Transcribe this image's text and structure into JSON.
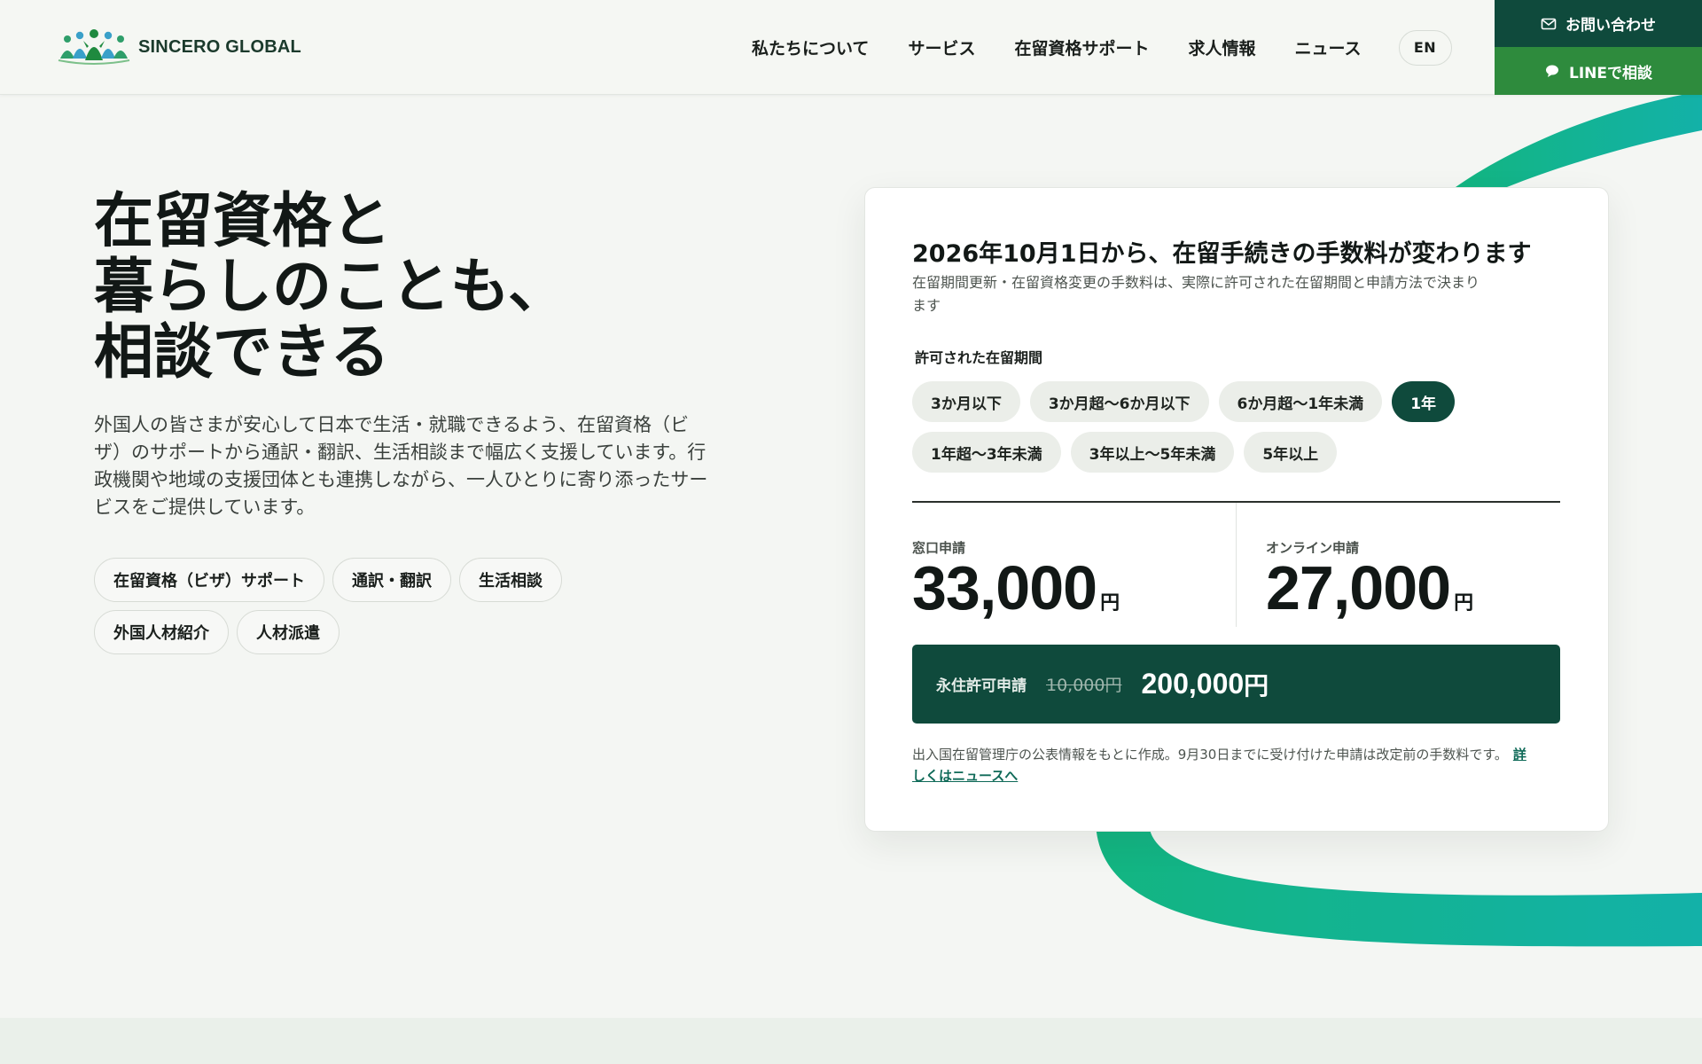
{
  "brand": {
    "name": "SINCERO GLOBAL"
  },
  "nav": {
    "items": [
      "私たちについて",
      "サービス",
      "在留資格サポート",
      "求人情報",
      "ニュース"
    ],
    "lang": "EN"
  },
  "header_cta": {
    "contact": "お問い合わせ",
    "line": "LINEで相談"
  },
  "hero": {
    "title_lines": [
      "在留資格と",
      "暮らしのことも、",
      "相談できる"
    ],
    "description": "外国人の皆さまが安心して日本で生活・就職できるよう、在留資格（ビザ）のサポートから通訳・翻訳、生活相談まで幅広く支援しています。行政機関や地域の支援団体とも連携しながら、一人ひとりに寄り添ったサービスをご提供しています。",
    "tags": [
      "在留資格（ビザ）サポート",
      "通訳・翻訳",
      "生活相談",
      "外国人材紹介",
      "人材派遣"
    ]
  },
  "fee_card": {
    "title": "2026年10月1日から、在留手続きの手数料が変わります",
    "subtitle": "在留期間更新・在留資格変更の手数料は、実際に許可された在留期間と申請方法で決まります",
    "period_label": "許可された在留期間",
    "periods": [
      "3か月以下",
      "3か月超〜6か月以下",
      "6か月超〜1年未満",
      "1年",
      "1年超〜3年未満",
      "3年以上〜5年未満",
      "5年以上"
    ],
    "selected_period": "1年",
    "window": {
      "label": "窓口申請",
      "amount": "33,000",
      "unit": "円"
    },
    "online": {
      "label": "オンライン申請",
      "amount": "27,000",
      "unit": "円"
    },
    "permanent": {
      "label": "永住許可申請",
      "old_price": "10,000円",
      "new_price": "200,000",
      "new_unit": "円"
    },
    "note": "出入国在留管理庁の公表情報をもとに作成。9月30日までに受け付けた申請は改定前の手数料です。",
    "note_link": "詳しくはニュースへ"
  },
  "colors": {
    "brand_dark": "#0f4a3c",
    "line_green": "#2e8b3d",
    "ribbon_start": "#13b581",
    "ribbon_end": "#13b1a8"
  }
}
